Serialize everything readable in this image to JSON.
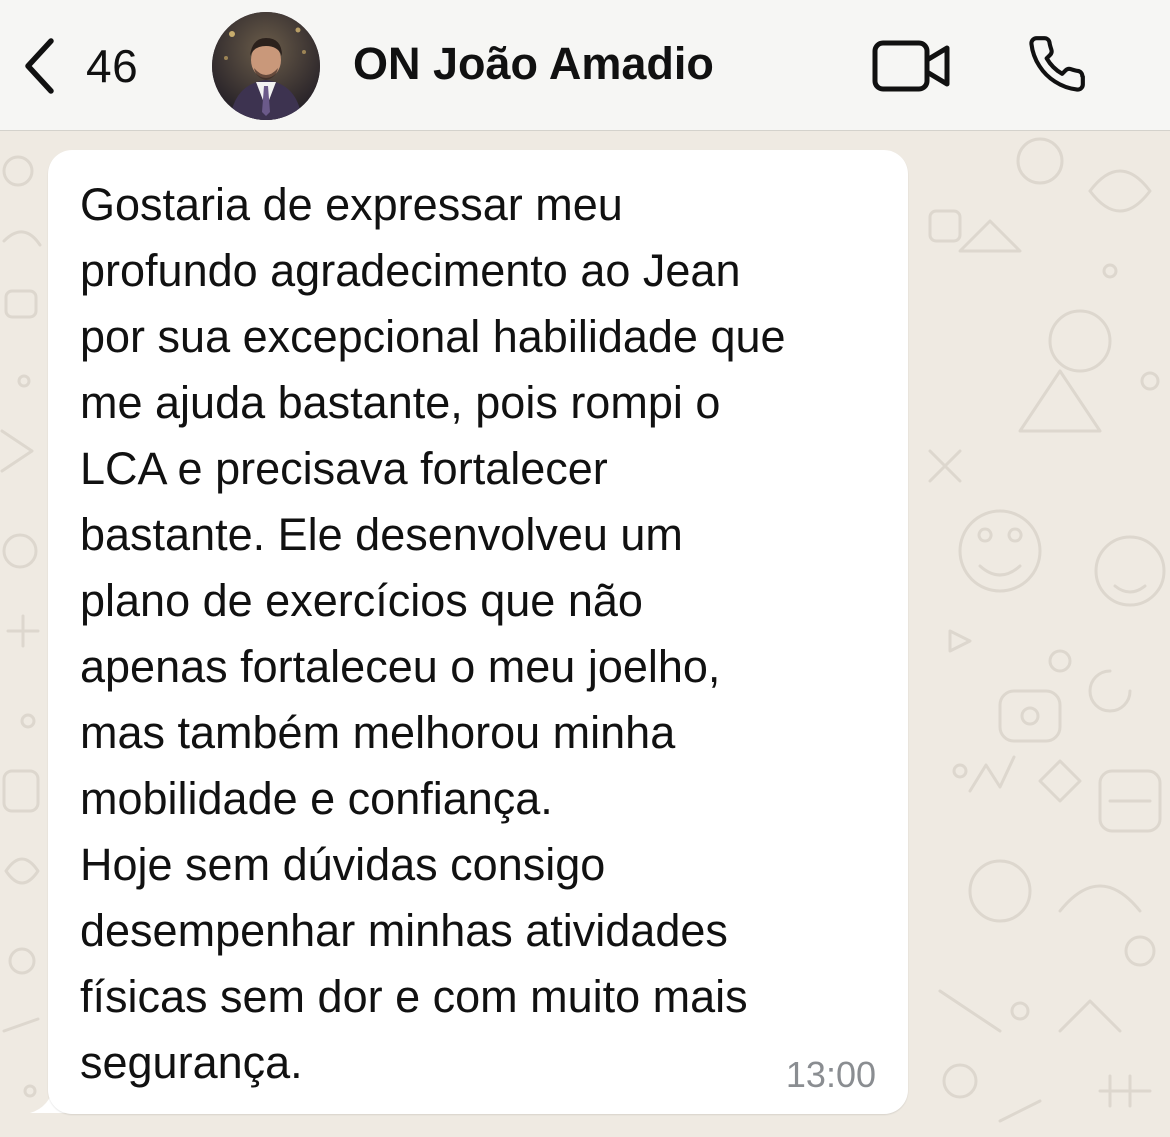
{
  "header": {
    "back_count": "46",
    "contact_name": "ON João Amadio"
  },
  "message": {
    "text": "Gostaria de expressar meu\nprofundo agradecimento ao Jean\npor sua excepcional habilidade que\nme ajuda bastante, pois rompi o\nLCA e precisava fortalecer\nbastante. Ele desenvolveu um\nplano de exercícios que não\napenas fortaleceu o meu joelho,\nmas também melhorou minha\nmobilidade e confiança.\nHoje sem dúvidas consigo\ndesempenhar minhas atividades\nfísicas sem dor e com muito mais\nsegurança.",
    "time": "13:00"
  },
  "icons": {
    "back": "chevron-left-icon",
    "video": "video-camera-icon",
    "call": "phone-icon"
  },
  "colors": {
    "wallpaper": "#efeae2",
    "bubble": "#ffffff",
    "header": "#f6f6f4",
    "timestamp": "#8a8d91"
  }
}
